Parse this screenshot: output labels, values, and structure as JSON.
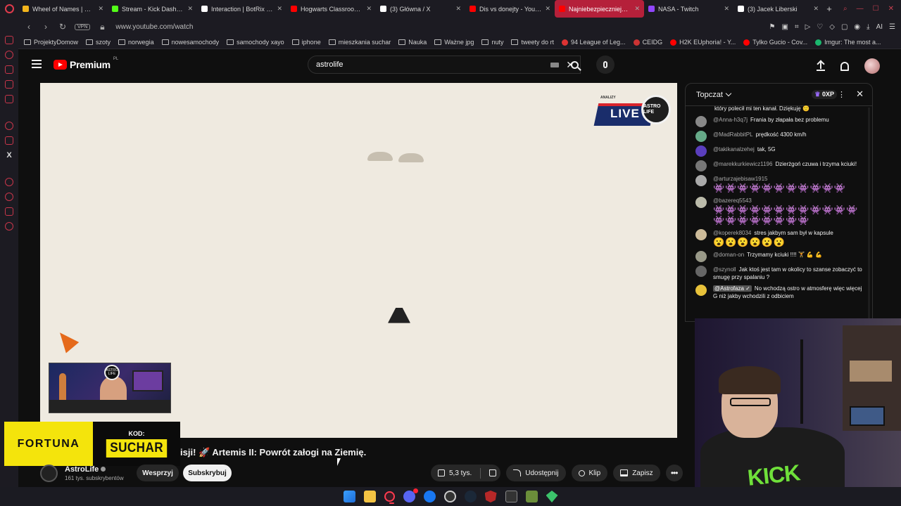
{
  "browser": {
    "tabs": [
      {
        "label": "Wheel of Names | Random Name Picker",
        "color": "#f2b41c",
        "active": false
      },
      {
        "label": "Stream - Kick Dashboard",
        "color": "#53fc18",
        "active": false
      },
      {
        "label": "Interaction | BotRix — Cl",
        "color": "#ffffff",
        "active": false
      },
      {
        "label": "Hogwarts Classroom | Ha",
        "color": "#ff0000",
        "active": false
      },
      {
        "label": "(3) Główna / X",
        "color": "#ffffff",
        "active": false
      },
      {
        "label": "Dis vs donejty - YouTube",
        "color": "#ff0000",
        "active": false
      },
      {
        "label": "Najniebezpieczniejszy",
        "color": "#ff0000",
        "active": true
      },
      {
        "label": "NASA - Twitch",
        "color": "#9146ff",
        "active": false
      },
      {
        "label": "(3) Jacek Liberski",
        "color": "#ffffff",
        "active": false
      }
    ],
    "vpn_label": "VPN",
    "url": "www.youtube.com/watch",
    "ai_label": "AI",
    "bookmarks": [
      {
        "label": "ProjektyDomow",
        "type": "folder"
      },
      {
        "label": "szoty",
        "type": "folder"
      },
      {
        "label": "norwegia",
        "type": "folder"
      },
      {
        "label": "nowesamochody",
        "type": "folder"
      },
      {
        "label": "samochody xayo",
        "type": "folder"
      },
      {
        "label": "iphone",
        "type": "folder"
      },
      {
        "label": "mieszkania suchar",
        "type": "folder"
      },
      {
        "label": "Nauka",
        "type": "folder"
      },
      {
        "label": "Ważne jpg",
        "type": "folder"
      },
      {
        "label": "nuty",
        "type": "folder"
      },
      {
        "label": "tweety do rt",
        "type": "folder"
      },
      {
        "label": "94 League of Leg...",
        "type": "site",
        "color": "#d33"
      },
      {
        "label": "CEIDG",
        "type": "site",
        "color": "#c33"
      },
      {
        "label": "H2K EUphoria! - Y...",
        "type": "site",
        "color": "#f00"
      },
      {
        "label": "Tylko Gucio - Cov...",
        "type": "site",
        "color": "#f00"
      },
      {
        "label": "Imgur: The most a...",
        "type": "site",
        "color": "#1bb76e"
      }
    ]
  },
  "youtube": {
    "logo_word": "Premium",
    "logo_country": "PL",
    "search_query": "astrolife"
  },
  "video": {
    "live_badge": "LIVE",
    "live_badge_small": "ANALIZY",
    "astro_logo": "ASTRO LIFE",
    "promo_brand": "FORTUNA",
    "promo_kod_label": "KOD:",
    "promo_code": "SUCHAR",
    "title": "isji! 🚀 Artemis II: Powrót załogi na Ziemię.",
    "channel_name": "AstroLife",
    "channel_subs": "161 tys. subskrybentów",
    "support_label": "Wesprzyj",
    "subscribe_label": "Subskrybuj",
    "likes": "5,3 tys.",
    "share_label": "Udostępnij",
    "clip_label": "Klip",
    "save_label": "Zapisz"
  },
  "chat": {
    "mode": "Topczat",
    "xp": "0XP",
    "partial_top": "który polecił mi ten kanał. Dziękuję 🙂",
    "messages": [
      {
        "author": "@Anna-h3q7j",
        "text": "Frania by złapała bez problemu",
        "color": "#888"
      },
      {
        "author": "@MadRabbitPL",
        "text": "prędkość 4300 km/h",
        "color": "#6a8"
      },
      {
        "author": "@takikanalzehej",
        "text": "tak, 5G",
        "color": "#5a3ebd"
      },
      {
        "author": "@marekkurkiewicz1196",
        "text": "Dzierżgoń czuwa i trzyma kciuki!",
        "color": "#777"
      },
      {
        "author": "@arturzajebisaw1915",
        "text": "",
        "emojis": "👾👾👾👾👾👾👾👾👾👾👾",
        "color": "#aaa"
      },
      {
        "author": "@bazereq5543",
        "text": "",
        "emojis": "👾👾👾👾👾👾👾👾👾👾👾👾👾👾👾👾👾👾👾👾",
        "color": "#bba"
      },
      {
        "author": "@koperek8034",
        "text": "stres jakbym sam był w kapsule",
        "emojis": "😮😮😮😮😮😮",
        "color": "#cb9"
      },
      {
        "author": "@doman-on",
        "text": "Trzymamy kciuki !!!! 🏋 💪 💪",
        "color": "#998"
      },
      {
        "author": "@szynoll",
        "text": "Jak ktoś jest tam w okolicy to szanse zobaczyć to smugę przy spalaniu ?",
        "color": "#666"
      },
      {
        "author": "@Astrofaza ✓",
        "text": "No wchodzą ostro w atmosferę więc więcej G niż jakby wchodzili z odbiciem",
        "color": "#e8c23a",
        "badge": true
      }
    ]
  },
  "webcam": {
    "hoodie_text": "KICK"
  }
}
